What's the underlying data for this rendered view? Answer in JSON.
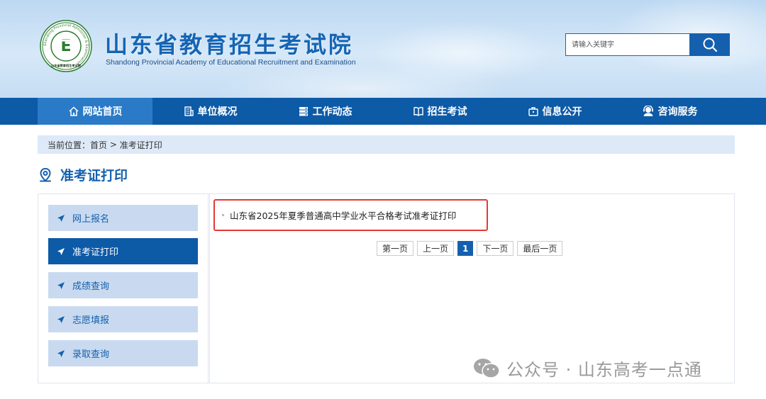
{
  "header": {
    "title": "山东省教育招生考试院",
    "subtitle": "Shandong Provincial Academy of Educational Recruitment and Examination",
    "emblem": {
      "ring_text": "Shandong Provincial Admission & Examination",
      "bottom_text": "山东省教育招生考试院",
      "letter": "E"
    },
    "search": {
      "placeholder": "请输入关键字"
    }
  },
  "nav": {
    "items": [
      {
        "label": "网站首页",
        "icon": "home-icon"
      },
      {
        "label": "单位概况",
        "icon": "building-icon"
      },
      {
        "label": "工作动态",
        "icon": "server-icon"
      },
      {
        "label": "招生考试",
        "icon": "book-icon"
      },
      {
        "label": "信息公开",
        "icon": "briefcase-icon"
      },
      {
        "label": "咨询服务",
        "icon": "support-icon"
      }
    ],
    "active_index": 0
  },
  "breadcrumb": {
    "prefix": "当前位置：",
    "home": "首页",
    "separator": " > ",
    "current": "准考证打印"
  },
  "page": {
    "title": "准考证打印"
  },
  "sidebar": {
    "items": [
      {
        "label": "网上报名"
      },
      {
        "label": "准考证打印"
      },
      {
        "label": "成绩查询"
      },
      {
        "label": "志愿填报"
      },
      {
        "label": "录取查询"
      }
    ],
    "active_index": 1
  },
  "articles": [
    {
      "title": "山东省2025年夏季普通高中学业水平合格考试准考证打印"
    }
  ],
  "pager": {
    "first": "第一页",
    "prev": "上一页",
    "current": "1",
    "next": "下一页",
    "last": "最后一页"
  },
  "watermark": {
    "text": "公众号 · 山东高考一点通"
  },
  "colors": {
    "primary": "#0d5aa7",
    "nav_active": "#2a7ac7",
    "sidebar_item": "#c9daf0",
    "breadcrumb_bg": "#dde9f7",
    "highlight_border": "#e53935"
  }
}
